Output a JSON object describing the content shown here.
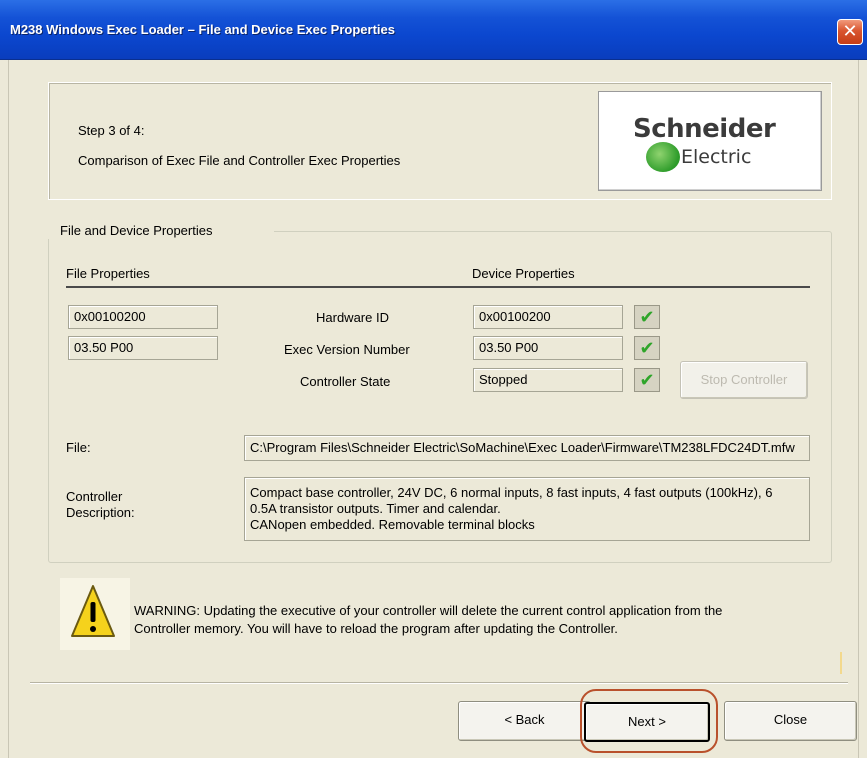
{
  "window": {
    "title": "M238 Windows Exec Loader – File and Device Exec Properties",
    "close_glyph": "✕"
  },
  "header": {
    "step": "Step 3 of 4:",
    "description": "Comparison of Exec File and Controller Exec Properties",
    "logo_word1": "Schneider",
    "logo_word2": "Electric"
  },
  "group": {
    "legend": "File and Device Properties",
    "file_properties_heading": "File Properties",
    "device_properties_heading": "Device Properties"
  },
  "rows": [
    {
      "label": "Hardware ID",
      "file_value": "0x00100200",
      "device_value": "0x00100200",
      "status_icon": "check-icon"
    },
    {
      "label": "Exec Version Number",
      "file_value": "03.50 P00",
      "device_value": "03.50 P00",
      "status_icon": "check-icon"
    },
    {
      "label": "Controller State",
      "device_value": "Stopped",
      "status_icon": "check-icon"
    }
  ],
  "stop_controller_label": "Stop Controller",
  "file": {
    "label": "File:",
    "path": "C:\\Program Files\\Schneider Electric\\SoMachine\\Exec Loader\\Firmware\\TM238LFDC24DT.mfw"
  },
  "controller_description": {
    "label_line1": "Controller",
    "label_line2": "Description:",
    "line1": "Compact base controller, 24V DC, 6 normal inputs, 8 fast inputs, 4 fast outputs (100kHz), 6",
    "line2": "0.5A transistor outputs. Timer and calendar.",
    "line3": "CANopen embedded. Removable terminal blocks"
  },
  "warning": {
    "icon": "warning-icon",
    "line1": "WARNING: Updating the executive of your controller will delete the current control application from the",
    "line2": "Controller memory. You will have to reload the program after updating the Controller."
  },
  "buttons": {
    "back": "< Back",
    "next": "Next >",
    "close": "Close"
  },
  "colors": {
    "titlebar": "#0b47cf",
    "dialog_bg": "#ece9d8",
    "check": "#2fa52a",
    "highlight": "#b9512c"
  }
}
